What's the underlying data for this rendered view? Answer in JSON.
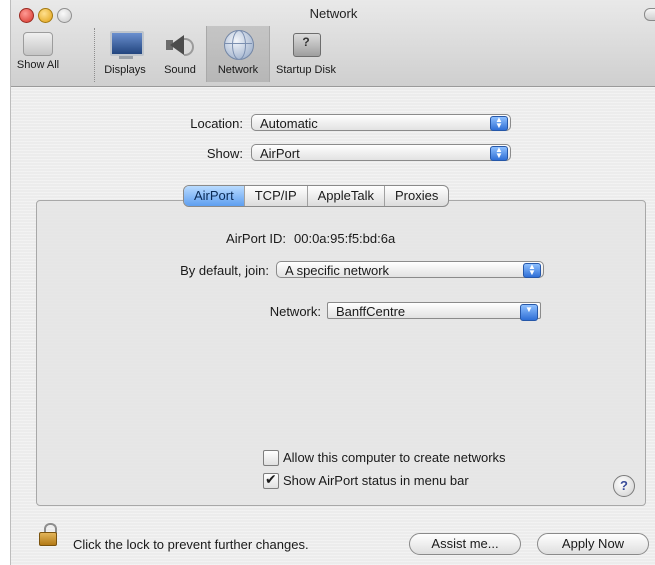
{
  "window": {
    "title": "Network"
  },
  "toolbar": {
    "items": [
      {
        "label": "Show All",
        "icon": "apple-grid-icon"
      },
      {
        "label": "Displays",
        "icon": "display-icon"
      },
      {
        "label": "Sound",
        "icon": "speaker-icon"
      },
      {
        "label": "Network",
        "icon": "globe-icon",
        "selected": true
      },
      {
        "label": "Startup Disk",
        "icon": "disk-icon"
      }
    ]
  },
  "location": {
    "label": "Location:",
    "value": "Automatic"
  },
  "show": {
    "label": "Show:",
    "value": "AirPort"
  },
  "tabs": [
    {
      "label": "AirPort",
      "active": true
    },
    {
      "label": "TCP/IP",
      "active": false
    },
    {
      "label": "AppleTalk",
      "active": false
    },
    {
      "label": "Proxies",
      "active": false
    }
  ],
  "airport": {
    "id_label": "AirPort ID:",
    "id_value": "00:0a:95:f5:bd:6a",
    "join_label": "By default, join:",
    "join_value": "A specific network",
    "network_label": "Network:",
    "network_value": "BanffCentre",
    "allow_create_label": "Allow this computer to create networks",
    "allow_create_checked": false,
    "show_status_label": "Show AirPort status in menu bar",
    "show_status_checked": true
  },
  "help": {
    "label": "?"
  },
  "footer": {
    "lock_text": "Click the lock to prevent further changes.",
    "assist_label": "Assist me...",
    "apply_label": "Apply Now"
  },
  "colors": {
    "accent": "#5e9ef0",
    "window_bg": "#ececec"
  }
}
